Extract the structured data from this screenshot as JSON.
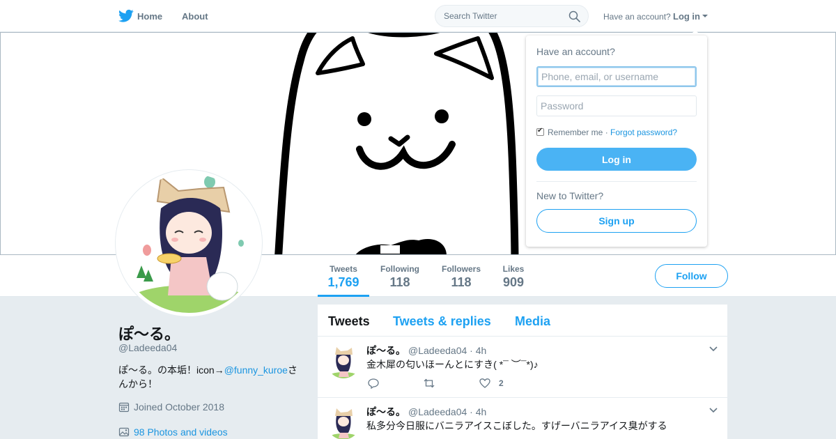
{
  "nav": {
    "home": "Home",
    "about": "About",
    "search_placeholder": "Search Twitter",
    "have_account": "Have an account?",
    "login": "Log in"
  },
  "profile": {
    "name": "ぽ〜る。",
    "handle": "@Ladeeda04",
    "bio_prefix": "ぽ〜る。の本垢！icon→",
    "bio_link": "@funny_kuroe",
    "bio_suffix": "さんから！",
    "joined": "Joined October 2018",
    "photos": "98 Photos and videos"
  },
  "stats": [
    {
      "label": "Tweets",
      "value": "1,769"
    },
    {
      "label": "Following",
      "value": "118"
    },
    {
      "label": "Followers",
      "value": "118"
    },
    {
      "label": "Likes",
      "value": "909"
    }
  ],
  "follow_label": "Follow",
  "tabs": [
    "Tweets",
    "Tweets & replies",
    "Media"
  ],
  "tweets": [
    {
      "name": "ぽ〜る。",
      "meta": "@Ladeeda04 · 4h",
      "text": "金木犀の匂いほーんとにすき( *¯ ︶¯*)♪",
      "likes": "2"
    },
    {
      "name": "ぽ〜る。",
      "meta": "@Ladeeda04 · 4h",
      "text": "私多分今日服にバニラアイスこぼした。すげーバニラアイス臭がする",
      "likes": ""
    }
  ],
  "login_dropdown": {
    "title": "Have an account?",
    "username_placeholder": "Phone, email, or username",
    "password_placeholder": "Password",
    "remember": "Remember me",
    "separator": "·",
    "forgot": "Forgot password?",
    "login_button": "Log in",
    "new_to": "New to Twitter?",
    "signup_button": "Sign up"
  },
  "colors": {
    "accent": "#1da1f2",
    "login_button": "#4ab3f4",
    "text_secondary": "#657786",
    "background": "#e6ecf0"
  }
}
